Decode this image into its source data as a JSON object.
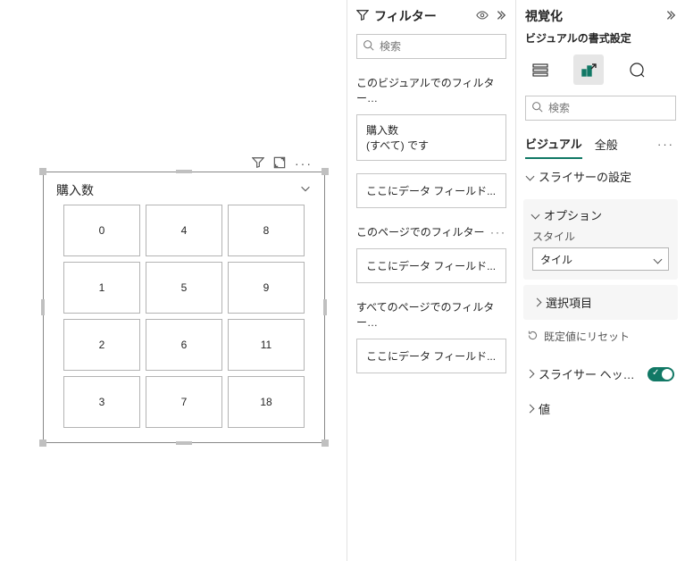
{
  "slicer": {
    "title": "購入数",
    "tiles": [
      "0",
      "4",
      "8",
      "1",
      "5",
      "9",
      "2",
      "6",
      "11",
      "3",
      "7",
      "18"
    ]
  },
  "filters": {
    "panelTitle": "フィルター",
    "searchPlaceholder": "検索",
    "onVisual": {
      "heading": "このビジュアルでのフィルター…",
      "fieldName": "購入数",
      "condition": "(すべて) です"
    },
    "onPage": {
      "heading": "このページでのフィルター",
      "dropText": "ここにデータ フィールド..."
    },
    "onAll": {
      "heading": "すべてのページでのフィルター…",
      "dropText": "ここにデータ フィールド..."
    },
    "visualDrop": "ここにデータ フィールド..."
  },
  "viz": {
    "panelTitle": "視覚化",
    "sub": "ビジュアルの書式設定",
    "searchPlaceholder": "検索",
    "tabs": {
      "visual": "ビジュアル",
      "general": "全般"
    },
    "slicerSettings": "スライサーの設定",
    "options": {
      "heading": "オプション",
      "styleLabel": "スタイル",
      "styleValue": "タイル"
    },
    "selection": "選択項目",
    "reset": "既定値にリセット",
    "header": "スライサー ヘッ…",
    "values": "値"
  }
}
